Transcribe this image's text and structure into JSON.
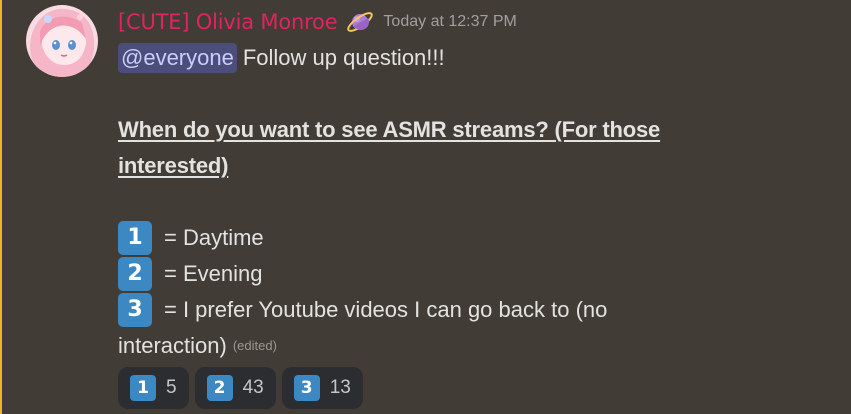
{
  "message": {
    "username": "[CUTE] Olivia Monroe",
    "badge_icon": "ringed-planet-icon",
    "timestamp": "Today at 12:37 PM",
    "mention": "@everyone",
    "intro_text": "Follow up question!!!",
    "title_line1": "When do you want to see ASMR streams? (For those",
    "title_line2": "interested)",
    "options": [
      {
        "key": "1",
        "text": "= Daytime"
      },
      {
        "key": "2",
        "text": "= Evening"
      },
      {
        "key": "3",
        "text": "= I prefer Youtube videos I can go back to (no"
      }
    ],
    "option3_continued": "interaction)",
    "edited_label": "(edited)"
  },
  "reactions": [
    {
      "key": "1",
      "count": "5"
    },
    {
      "key": "2",
      "count": "43"
    },
    {
      "key": "3",
      "count": "13"
    }
  ],
  "colors": {
    "background": "#413c35",
    "mention_bar": "#f0b232",
    "username": "#e0245e",
    "keycap": "#3b88c3",
    "mention_bg": "#4b4d7a"
  }
}
